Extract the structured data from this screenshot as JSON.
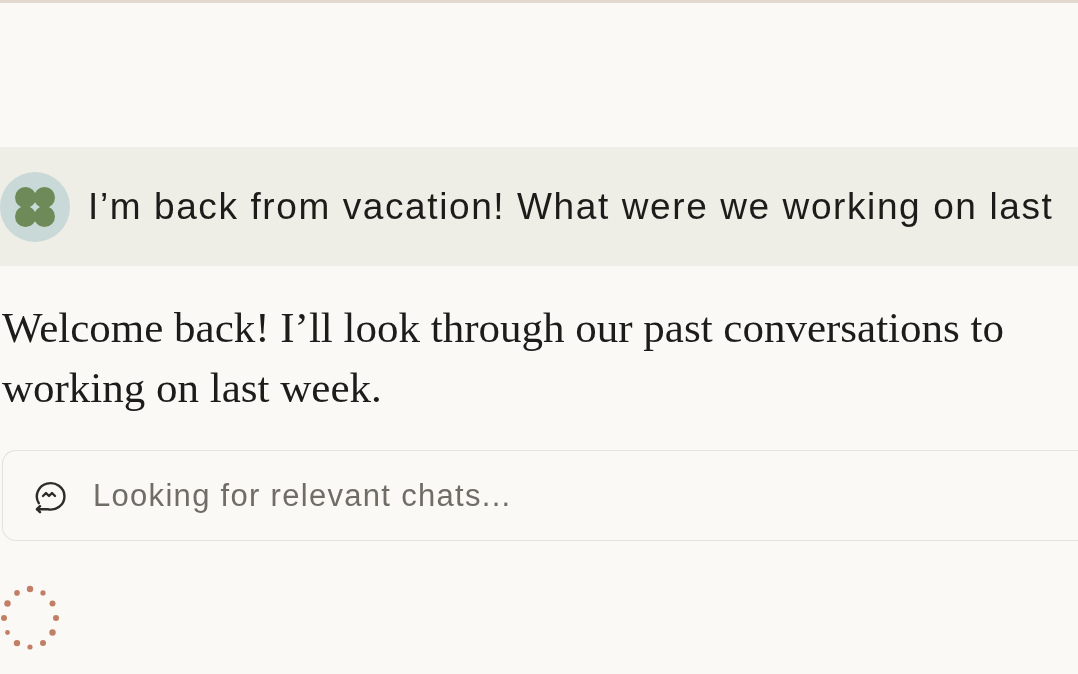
{
  "user_message": {
    "text": "I’m back from vacation! What were we working on last"
  },
  "assistant_message": {
    "lines": [
      "Welcome back! I’ll look through our past conversations to",
      "working on last week."
    ]
  },
  "tool_status": {
    "text": "Looking for relevant chats..."
  }
}
